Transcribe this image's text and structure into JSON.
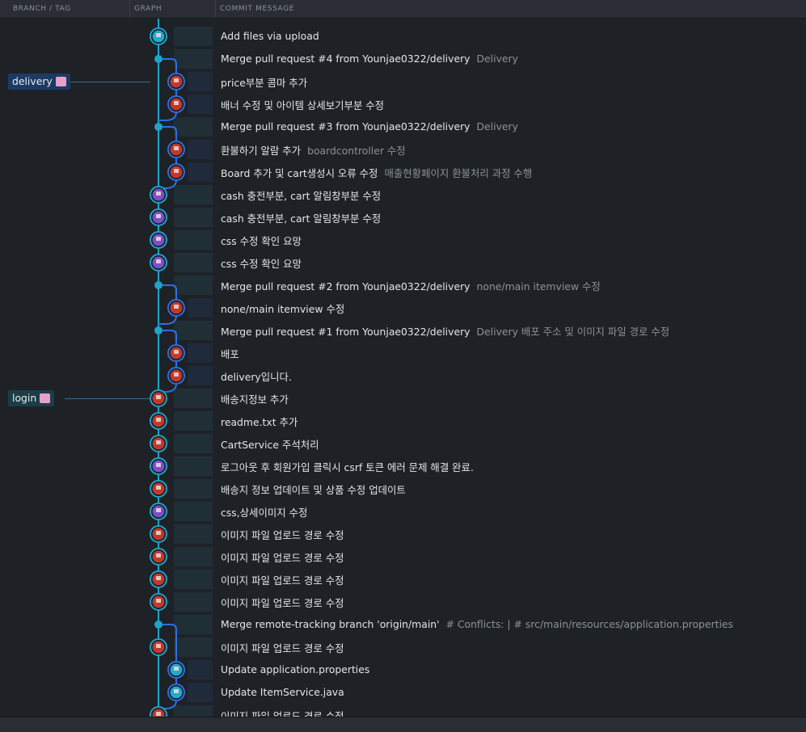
{
  "header": {
    "branch_tag": "BRANCH / TAG",
    "graph": "GRAPH",
    "commit_message": "COMMIT MESSAGE"
  },
  "branches": [
    {
      "label": "delivery",
      "row": 3
    },
    {
      "label": "login",
      "row": 17
    }
  ],
  "commits": [
    {
      "message": "Add files via upload",
      "desc": "",
      "lane": "main",
      "avatar": "cyan"
    },
    {
      "message": "Merge pull request #4 from Younjae0322/delivery",
      "desc": "Delivery",
      "lane": "merge",
      "avatar": ""
    },
    {
      "message": "price부분 콤마 추가",
      "desc": "",
      "lane": "sub",
      "avatar": "red"
    },
    {
      "message": "배너 수정 및 아이템 상세보기부분 수정",
      "desc": "",
      "lane": "sub",
      "avatar": "red"
    },
    {
      "message": "Merge pull request #3 from Younjae0322/delivery",
      "desc": "Delivery",
      "lane": "merge",
      "avatar": ""
    },
    {
      "message": "환불하기 알람 추가",
      "desc": "boardcontroller 수정",
      "lane": "sub",
      "avatar": "red"
    },
    {
      "message": "Board 추가 및 cart생성시 오류 수정",
      "desc": "매출현황페이지 환불처리 과정 수행",
      "lane": "sub",
      "avatar": "red"
    },
    {
      "message": "cash 충전부분, cart 알림창부분 수정",
      "desc": "",
      "lane": "main",
      "avatar": "purple"
    },
    {
      "message": "cash 충전부분, cart 알림창부분 수정",
      "desc": "",
      "lane": "main",
      "avatar": "purple"
    },
    {
      "message": "css 수정 확인 요망",
      "desc": "",
      "lane": "main",
      "avatar": "purple"
    },
    {
      "message": "css 수정 확인 요망",
      "desc": "",
      "lane": "main",
      "avatar": "purple"
    },
    {
      "message": "Merge pull request #2 from Younjae0322/delivery",
      "desc": "none/main itemview 수정",
      "lane": "merge",
      "avatar": ""
    },
    {
      "message": "none/main itemview 수정",
      "desc": "",
      "lane": "sub",
      "avatar": "red"
    },
    {
      "message": "Merge pull request #1 from Younjae0322/delivery",
      "desc": "Delivery 배포 주소 및 이미지 파일 경로 수정",
      "lane": "merge",
      "avatar": ""
    },
    {
      "message": "배포",
      "desc": "",
      "lane": "sub",
      "avatar": "red"
    },
    {
      "message": "delivery입니다.",
      "desc": "",
      "lane": "sub",
      "avatar": "red"
    },
    {
      "message": "배송지정보 추가",
      "desc": "",
      "lane": "main",
      "avatar": "red"
    },
    {
      "message": "readme.txt 추가",
      "desc": "",
      "lane": "main",
      "avatar": "red"
    },
    {
      "message": "CartService 주석처리",
      "desc": "",
      "lane": "main",
      "avatar": "red"
    },
    {
      "message": "로그아웃 후 회원가입 클릭시 csrf 토큰 에러 문제 해결 완료.",
      "desc": "",
      "lane": "main",
      "avatar": "purple"
    },
    {
      "message": "배송지 정보 업데이트 및 상품 수정 업데이트",
      "desc": "",
      "lane": "main",
      "avatar": "red"
    },
    {
      "message": "css,상세이미지 수정",
      "desc": "",
      "lane": "main",
      "avatar": "purple"
    },
    {
      "message": "이미지 파일 업로드 경로 수정",
      "desc": "",
      "lane": "main",
      "avatar": "red"
    },
    {
      "message": "이미지 파일 업로드 경로 수정",
      "desc": "",
      "lane": "main",
      "avatar": "red"
    },
    {
      "message": "이미지 파일 업로드 경로 수정",
      "desc": "",
      "lane": "main",
      "avatar": "red"
    },
    {
      "message": "이미지 파일 업로드 경로 수정",
      "desc": "",
      "lane": "main",
      "avatar": "red"
    },
    {
      "message": "Merge remote-tracking branch 'origin/main'",
      "desc": "# Conflicts: | # src/main/resources/application.properties",
      "lane": "merge",
      "avatar": ""
    },
    {
      "message": "이미지 파일 업로드 경로 수정",
      "desc": "",
      "lane": "main",
      "avatar": "red"
    },
    {
      "message": "Update application.properties",
      "desc": "",
      "lane": "sub2",
      "avatar": "cyan"
    },
    {
      "message": "Update ItemService.java",
      "desc": "",
      "lane": "sub2",
      "avatar": "cyan"
    },
    {
      "message": "이미지 파일 업로드 경로 수정",
      "desc": "",
      "lane": "main",
      "avatar": "red"
    }
  ],
  "colors": {
    "main_line": "#1fa3c7",
    "sub_line": "#2f6fe0",
    "avatar_red": "#c0392b",
    "avatar_purple": "#7b4fc9",
    "avatar_cyan": "#24a9c9",
    "branch_delivery_bg": "#1d3a64",
    "branch_login_bg": "#1c3d47"
  }
}
